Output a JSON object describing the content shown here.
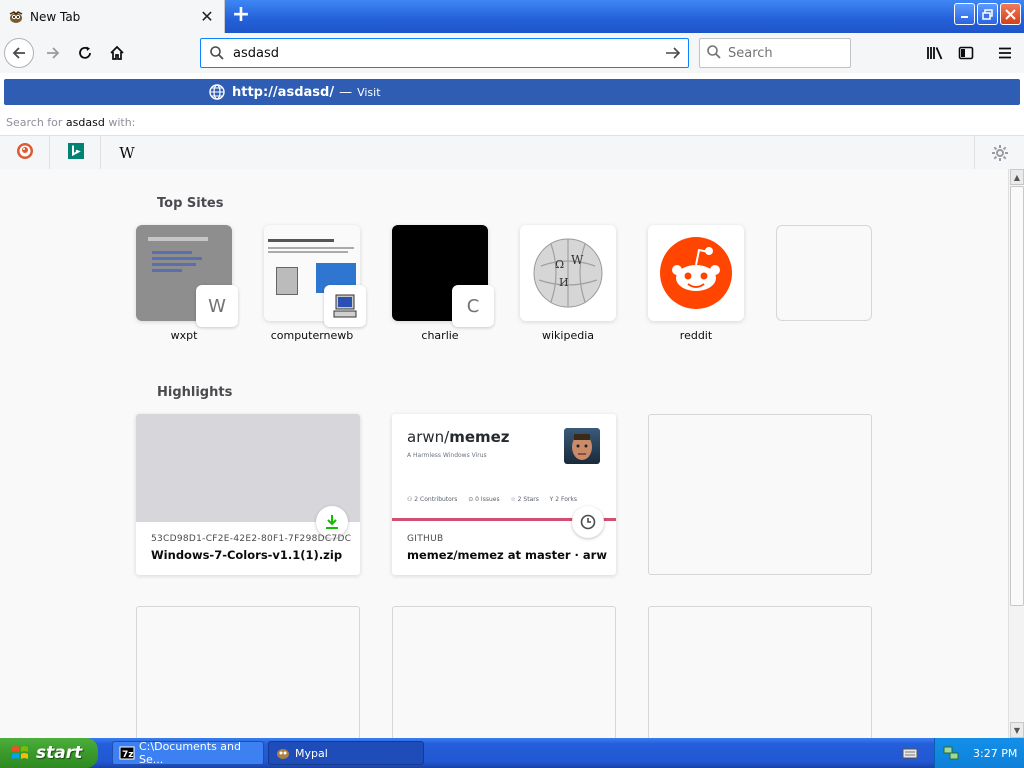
{
  "tab": {
    "title": "New Tab"
  },
  "toolbar": {
    "url_value": "asdasd",
    "search_placeholder": "Search"
  },
  "dropdown": {
    "visit_url": "http://asdasd/",
    "visit_sep": "—",
    "visit_action": "Visit",
    "search_for_prefix": "Search for",
    "search_for_term": "asdasd",
    "search_for_suffix": "with:",
    "engines": [
      "DuckDuckGo",
      "Bing",
      "Wikipedia"
    ],
    "wiki_glyph": "W"
  },
  "top_sites": {
    "heading": "Top Sites",
    "tiles": [
      {
        "label": "wxpt",
        "badge": "W"
      },
      {
        "label": "computernewb",
        "badge": ""
      },
      {
        "label": "charlie",
        "badge": "C"
      },
      {
        "label": "wikipedia",
        "badge": ""
      },
      {
        "label": "reddit",
        "badge": ""
      }
    ]
  },
  "highlights": {
    "heading": "Highlights",
    "cards": [
      {
        "context": "53CD98D1-CF2E-42E2-80F1-7F298DC7DC1...",
        "title": "Windows-7-Colors-v1.1(1).zip",
        "icon": "download-icon"
      },
      {
        "context": "GITHUB",
        "title": "memez/memez at master · arw...",
        "icon": "clock-icon",
        "preview_owner": "arwn/",
        "preview_repo": "memez",
        "preview_desc": "A Harmless Windows Virus",
        "stats": [
          "2",
          "0",
          "2",
          "2"
        ],
        "stat_labels": [
          "Contributors",
          "Issues",
          "Stars",
          "Forks"
        ]
      }
    ]
  },
  "taskbar": {
    "start_label": "start",
    "tasks": [
      "C:\\Documents and Se...",
      "Mypal"
    ],
    "clock": "3:27 PM"
  },
  "colors": {
    "accent": "#0a84ff",
    "visit_bg": "#2e5db3",
    "reddit": "#ff4500"
  }
}
